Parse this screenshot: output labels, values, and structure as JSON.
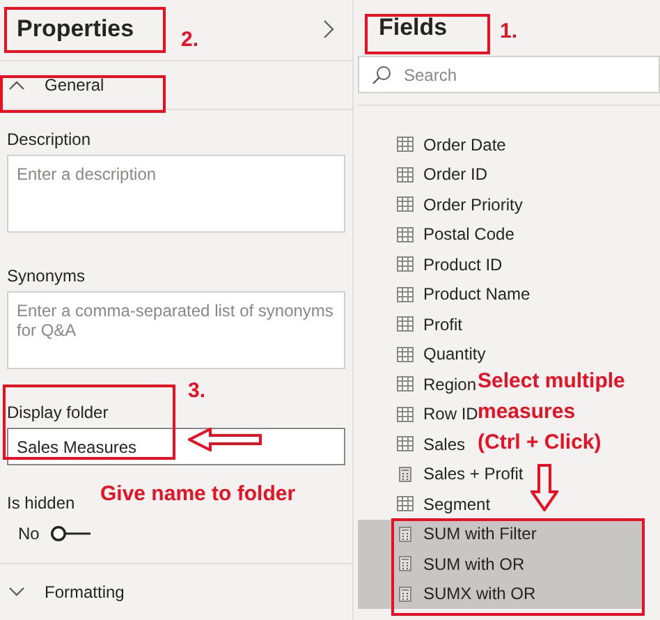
{
  "properties": {
    "title": "Properties",
    "title_highlighted": true,
    "title_marker": "2.",
    "general": {
      "label": "General",
      "expanded": true,
      "highlighted": true
    },
    "description": {
      "label": "Description",
      "placeholder": "Enter a description"
    },
    "synonyms": {
      "label": "Synonyms",
      "placeholder": "Enter a comma-separated list of synonyms for Q&A"
    },
    "display_folder": {
      "label": "Display folder",
      "value": "Sales Measures",
      "highlighted": true,
      "marker": "3.",
      "note": "Give name to folder"
    },
    "is_hidden": {
      "label": "Is hidden",
      "value_text": "No",
      "on": false
    },
    "formatting": {
      "label": "Formatting",
      "expanded": false
    }
  },
  "fields": {
    "title": "Fields",
    "title_highlighted": true,
    "title_marker": "1.",
    "search": {
      "placeholder": "Search"
    },
    "items": [
      {
        "name": "Order Date",
        "kind": "column",
        "selected": false
      },
      {
        "name": "Order ID",
        "kind": "column",
        "selected": false
      },
      {
        "name": "Order Priority",
        "kind": "column",
        "selected": false
      },
      {
        "name": "Postal Code",
        "kind": "column",
        "selected": false
      },
      {
        "name": "Product ID",
        "kind": "column",
        "selected": false
      },
      {
        "name": "Product Name",
        "kind": "column",
        "selected": false
      },
      {
        "name": "Profit",
        "kind": "column",
        "selected": false
      },
      {
        "name": "Quantity",
        "kind": "column",
        "selected": false
      },
      {
        "name": "Region",
        "kind": "column",
        "selected": false
      },
      {
        "name": "Row ID",
        "kind": "column",
        "selected": false
      },
      {
        "name": "Sales",
        "kind": "column",
        "selected": false
      },
      {
        "name": "Sales + Profit",
        "kind": "measure",
        "selected": false
      },
      {
        "name": "Segment",
        "kind": "column",
        "selected": false
      },
      {
        "name": "SUM with Filter",
        "kind": "measure",
        "selected": true
      },
      {
        "name": "SUM with OR",
        "kind": "measure",
        "selected": true
      },
      {
        "name": "SUMX with OR",
        "kind": "measure",
        "selected": true
      }
    ],
    "selection_highlighted": true,
    "note": "Select multiple\nmeasures\n(Ctrl + Click)"
  }
}
